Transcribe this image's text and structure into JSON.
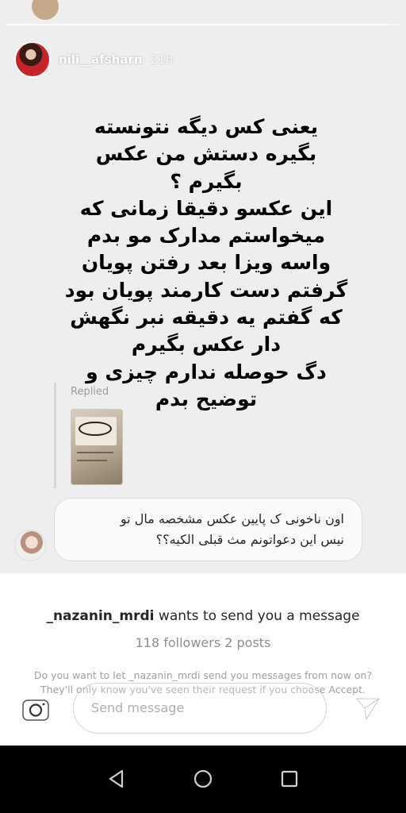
{
  "story": {
    "progress_fraction": 0.97,
    "username": "nili__afsharn",
    "time_ago": "21h",
    "text_lines": [
      "یعنی کس دیگه نتونسته",
      "بگیره دستش من عکس",
      "بگیرم ؟",
      "این عکسو دقیقا زمانی که",
      "میخواستم مدارک مو بدم",
      "واسه ویزا بعد رفتن پویان",
      "گرفتم دست کارمند پویان بود",
      "که گفتم یه دقیقه نبر نگهش",
      "دار عکس بگیرم",
      "دگ حوصله ندارم چیزی و",
      "توضیح بدم"
    ],
    "reply_label": "Replied"
  },
  "message": {
    "lines": [
      "اون ناخونی ک پایین عکس مشخصه مال تو",
      "نیس این دعواتونم مث قبلی الکیه؟؟"
    ]
  },
  "request": {
    "username": "_nazanin_mrdi",
    "title_suffix": " wants to send you a message",
    "stats": "118 followers 2 posts",
    "note": "Do you want to let _nazanin_mrdi send you messages from now on? They'll only know you've seen their request if you choose Accept."
  },
  "composer": {
    "placeholder": "Send message"
  },
  "icons": {
    "camera": "camera-icon",
    "send": "send-icon",
    "back": "nav-back-icon",
    "home": "nav-home-icon",
    "recents": "nav-recents-icon"
  },
  "colors": {
    "story_bg": "#eeeeee",
    "text": "#262626",
    "muted": "#8e8e8e"
  }
}
